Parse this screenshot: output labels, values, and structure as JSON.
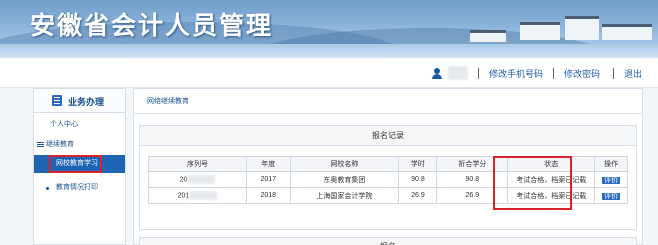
{
  "banner": {
    "title": "安徽省会计人员管理"
  },
  "topbar": {
    "links": [
      "修改手机号码",
      "修改密码",
      "退出"
    ]
  },
  "sidebar": {
    "header": "业务办理",
    "items": [
      {
        "label": "个人中心"
      },
      {
        "label": "继续教育"
      },
      {
        "label": "网校教育学习"
      },
      {
        "label": "教育情况打印"
      }
    ]
  },
  "main": {
    "title": "网络继续教育",
    "card_title": "报名记录",
    "next_card_title": "报名",
    "columns": [
      "序列号",
      "年度",
      "网校名称",
      "学时",
      "折合学分",
      "状态",
      "操作"
    ],
    "rows": [
      {
        "serial_prefix": "20",
        "year": "2017",
        "school": "东奥教育集团",
        "hours": "90.8",
        "credits": "90.8",
        "status": "考试合格，档案已记载",
        "action": "评价"
      },
      {
        "serial_prefix": "201",
        "year": "2018",
        "school": "上海国家会计学院",
        "hours": "26.9",
        "credits": "26.9",
        "status": "考试合格，档案已记载",
        "action": "评价"
      }
    ]
  },
  "colors": {
    "accent": "#1e64b4",
    "highlight": "#d9232a",
    "link": "#1b5fa8"
  }
}
